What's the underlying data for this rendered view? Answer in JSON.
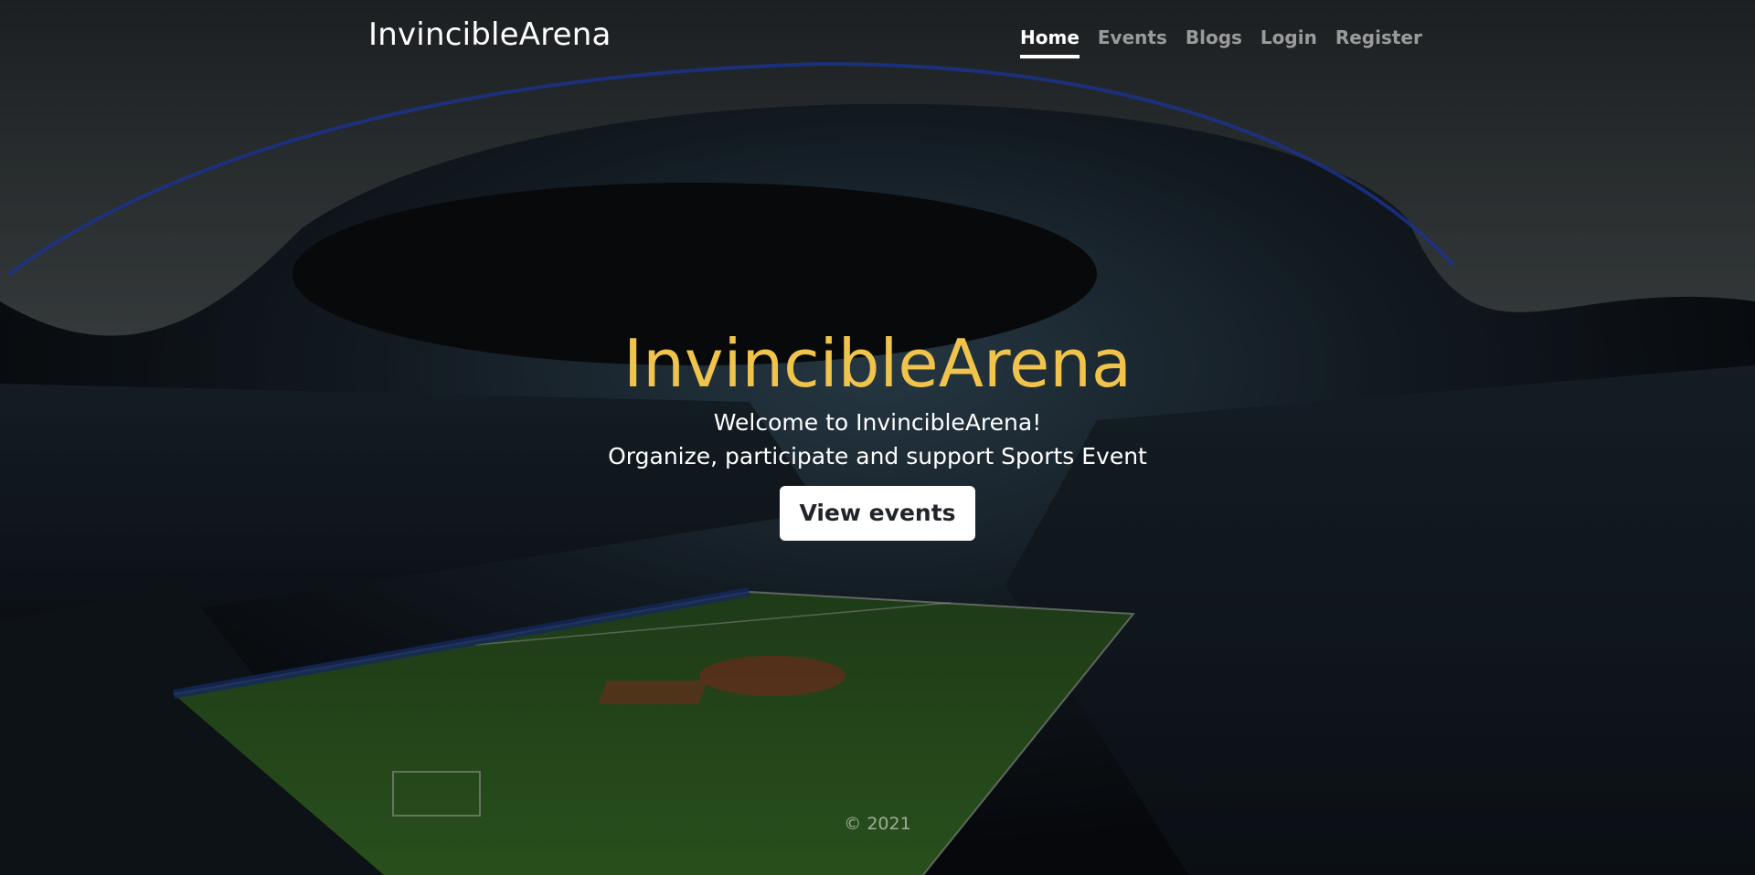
{
  "header": {
    "brand": "InvincibleArena",
    "nav": [
      {
        "label": "Home",
        "active": true
      },
      {
        "label": "Events",
        "active": false
      },
      {
        "label": "Blogs",
        "active": false
      },
      {
        "label": "Login",
        "active": false
      },
      {
        "label": "Register",
        "active": false
      }
    ]
  },
  "hero": {
    "title": "InvincibleArena",
    "line1": "Welcome to InvincibleArena!",
    "line2": "Organize, participate and support Sports Event",
    "button_label": "View events"
  },
  "footer": {
    "copyright": "© 2021"
  },
  "colors": {
    "title_accent": "#f0c44c",
    "button_bg": "#ffffff",
    "nav_active": "#ffffff",
    "nav_inactive": "rgba(255,255,255,0.55)"
  },
  "background": {
    "image_description_icon": "stadium-background-image"
  }
}
